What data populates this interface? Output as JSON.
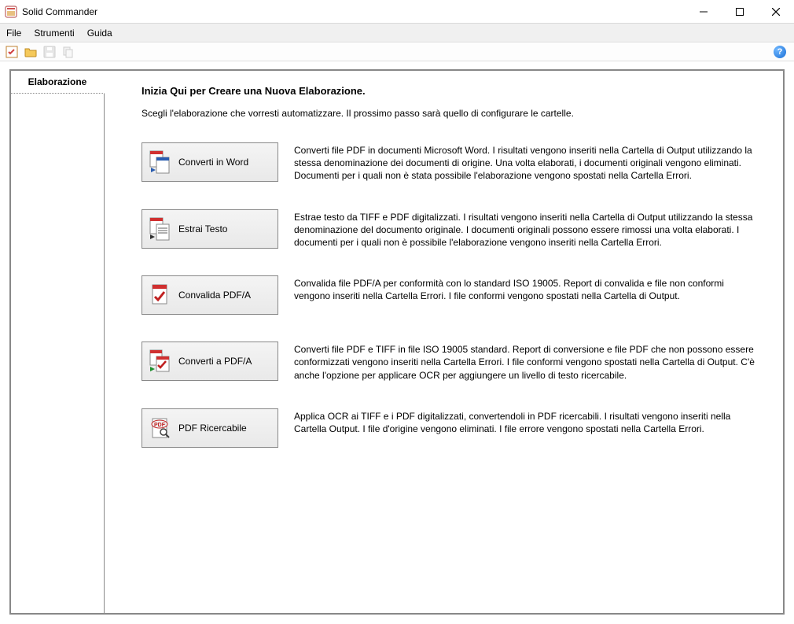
{
  "window": {
    "title": "Solid Commander"
  },
  "menu": {
    "file": "File",
    "tools": "Strumenti",
    "help": "Guida"
  },
  "sidebar": {
    "tab_label": "Elaborazione"
  },
  "content": {
    "heading": "Inizia Qui per Creare una Nuova Elaborazione.",
    "subtext": "Scegli l'elaborazione che vorresti automatizzare. Il prossimo passo sarà quello di configurare le cartelle.",
    "options": [
      {
        "label": "Converti in Word",
        "desc": "Converti file PDF in documenti Microsoft Word. I risultati vengono inseriti nella Cartella di Output utilizzando la stessa denominazione dei documenti di origine. Una volta elaborati, i documenti originali vengono eliminati. Documenti per i quali non è stata possibile l'elaborazione vengono spostati nella Cartella Errori."
      },
      {
        "label": "Estrai Testo",
        "desc": "Estrae testo da TIFF e PDF digitalizzati. I risultati vengono inseriti nella Cartella di Output utilizzando la stessa denominazione del documento originale. I documenti originali possono essere rimossi una volta elaborati. I documenti per i quali non è possibile l'elaborazione vengono inseriti nella Cartella Errori."
      },
      {
        "label": "Convalida PDF/A",
        "desc": "Convalida file PDF/A per conformità con lo standard ISO 19005. Report di convalida e file non conformi vengono inseriti nella Cartella Errori. I file conformi vengono spostati nella Cartella di Output."
      },
      {
        "label": "Converti a PDF/A",
        "desc": "Converti file PDF e TIFF in file ISO 19005 standard. Report di conversione e file PDF che non possono essere conformizzati vengono inseriti nella Cartella Errori. I file conformi vengono spostati nella Cartella di Output. C'è anche l'opzione per applicare OCR per aggiungere un livello di testo ricercabile."
      },
      {
        "label": "PDF Ricercabile",
        "desc": "Applica OCR ai TIFF e i PDF digitalizzati, convertendoli in PDF ricercabili. I risultati vengono inseriti nella Cartella Output. I file d'origine vengono eliminati. I file errore vengono spostati nella Cartella Errori."
      }
    ]
  }
}
